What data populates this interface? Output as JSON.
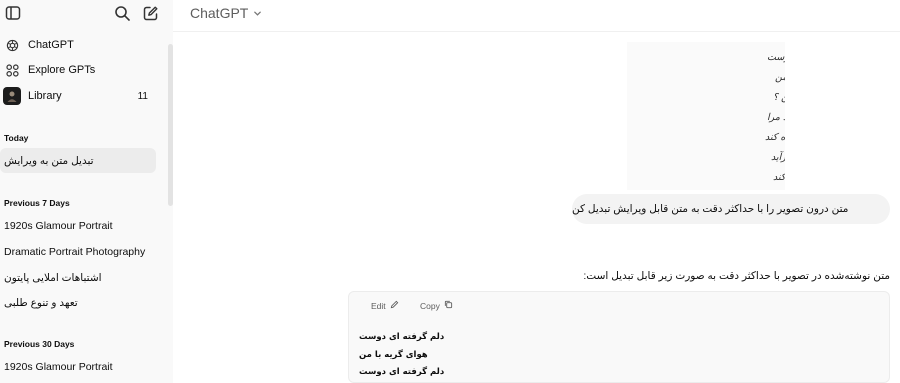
{
  "sidebar": {
    "nav": [
      {
        "label": "ChatGPT",
        "icon": "chatgpt-logo-icon",
        "count": ""
      },
      {
        "label": "Explore GPTs",
        "icon": "grid-icon",
        "count": ""
      },
      {
        "label": "Library",
        "icon": "library-thumbnail-icon",
        "count": "11"
      }
    ],
    "sections": [
      {
        "title": "Today",
        "items": [
          "تبدیل متن به ویرایش"
        ]
      },
      {
        "title": "Previous 7 Days",
        "items": [
          "1920s Glamour Portrait",
          "Dramatic Portrait Photography",
          "اشتباهات املایی پایتون",
          "تعهد و تنوع طلبی"
        ]
      },
      {
        "title": "Previous 30 Days",
        "items": [
          "1920s Glamour Portrait"
        ]
      }
    ]
  },
  "header": {
    "model": "ChatGPT"
  },
  "conversation": {
    "user_message": "متن درون تصویر را با حداکثر دقت به متن قابل ویرایش تبدیل کن",
    "assistant_intro": "متن نوشته‌شده در تصویر با حداکثر دقت به صورت زیر قابل تبدیل است:",
    "code_actions": {
      "edit": "Edit",
      "copy": "Copy"
    },
    "code_lines": [
      "دلم گرفته ای دوست",
      "هوای گریه با من",
      "دلم گرفته ای دوست"
    ],
    "photo_handwriting": [
      "دلم گرفته ای دوست",
      "دلم گرفته ای دوست هوای گریه با من",
      "گر از قفس گریزم کجا روم ، کجا من ؟",
      "کجا روم ، که راهی بگشاید مرا",
      "که دیده، بگشایم هر آنچه نگاه کند",
      "نسیم آشنایی از سرزمینی برآید",
      "چشمهٔ پاره پاره، دل ما، رها کند"
    ]
  },
  "colors": {
    "sidebar_bg": "#f9f9f9",
    "active_item": "#ececec",
    "bubble": "#f3f3f3",
    "code_bg": "#f9f9f9"
  }
}
